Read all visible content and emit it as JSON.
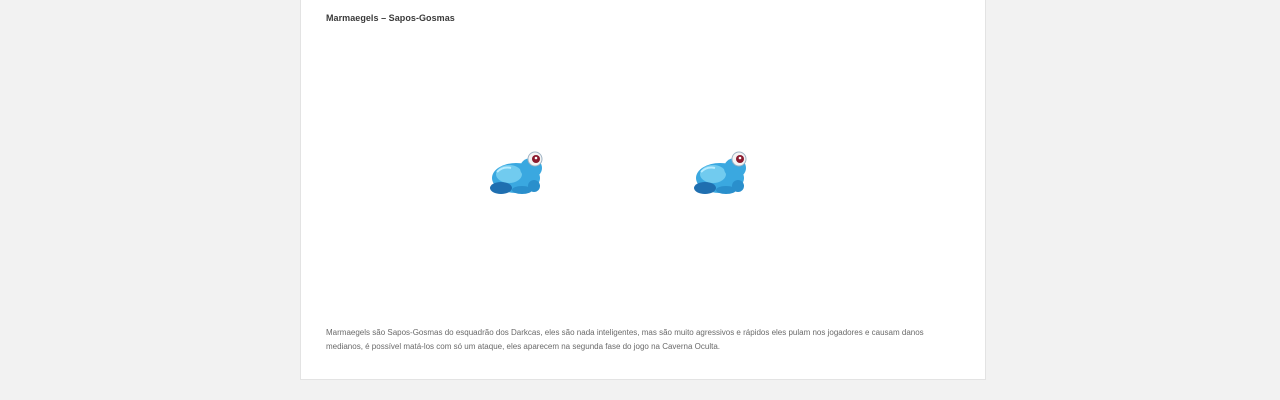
{
  "article": {
    "title": "Marmaegels – Sapos-Gosmas",
    "description": "Marmaegels são Sapos-Gosmas do esquadrão dos Darkcas, eles são nada inteligentes, mas são muito agressivos e rápidos eles pulam nos jogadores e causam danos medianos, é possível matá-los com só um ataque, eles aparecem na segunda fase do jogo na Caverna Oculta."
  },
  "sprites": [
    {
      "icon": "blue-frog-sprite-icon"
    },
    {
      "icon": "blue-frog-sprite-icon"
    }
  ],
  "colors": {
    "page_background": "#f2f2f2",
    "card_background": "#ffffff",
    "frog_light": "#7fd3f2",
    "frog_main": "#3aa8e0",
    "frog_dark": "#1f6fb0",
    "eye_red": "#8b1a2e"
  }
}
